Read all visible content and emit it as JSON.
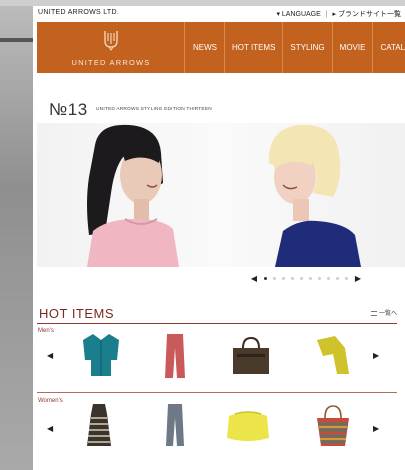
{
  "util": {
    "brand": "UNITED ARROWS LTD.",
    "language": "▾ LANGUAGE",
    "divider": "|",
    "brand_sites": "▸ ブランドサイト一覧"
  },
  "header": {
    "logo_text": "UNITED ARROWS",
    "nav": [
      "NEWS",
      "HOT ITEMS",
      "STYLING",
      "MOVIE",
      "CATALO"
    ]
  },
  "feature": {
    "issue": "№13",
    "subtitle": "UNITED ARROWS STYLING EDITION THIRTEEN"
  },
  "carousel": {
    "prev": "◀",
    "next": "▶",
    "dot_count": 10,
    "active_index": 0
  },
  "hot_items": {
    "title": "HOT ITEMS",
    "list_link": "一覧へ",
    "rows": [
      {
        "label": "Men's",
        "prev": "◀",
        "next": "▶",
        "items": [
          "teal-cardigan",
          "red-trousers",
          "brown-tote-bag",
          "yellow-scarf"
        ]
      },
      {
        "label": "Women's",
        "prev": "◀",
        "next": "▶",
        "items": [
          "striped-dress",
          "grey-trousers",
          "yellow-clutch",
          "woven-basket-bag"
        ]
      }
    ]
  },
  "colors": {
    "header_orange": "#c3621f",
    "accent_red": "#8e3a30"
  }
}
